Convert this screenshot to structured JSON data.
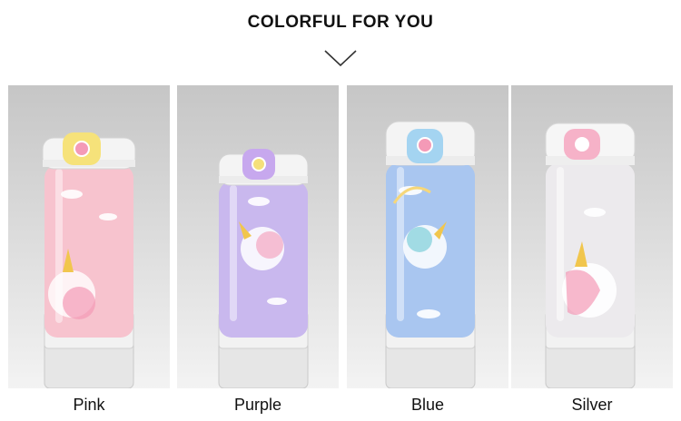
{
  "header": {
    "title": "COLORFUL FOR YOU"
  },
  "icons": {
    "chevron": "chevron-down-icon"
  },
  "products": [
    {
      "label": "Pink",
      "body_color": "#f7c3ce",
      "cap_button_color": "#f6e27a",
      "cap_knob_color": "#f49ab7"
    },
    {
      "label": "Purple",
      "body_color": "#c9b8ee",
      "cap_button_color": "#c7a8ee",
      "cap_knob_color": "#f5e07b"
    },
    {
      "label": "Blue",
      "body_color": "#a9c6f0",
      "cap_button_color": "#a4d4f1",
      "cap_knob_color": "#f49ab7"
    },
    {
      "label": "Silver",
      "body_color": "#eceaed",
      "cap_button_color": "#f6b2c8",
      "cap_knob_color": "#ffffff"
    }
  ]
}
